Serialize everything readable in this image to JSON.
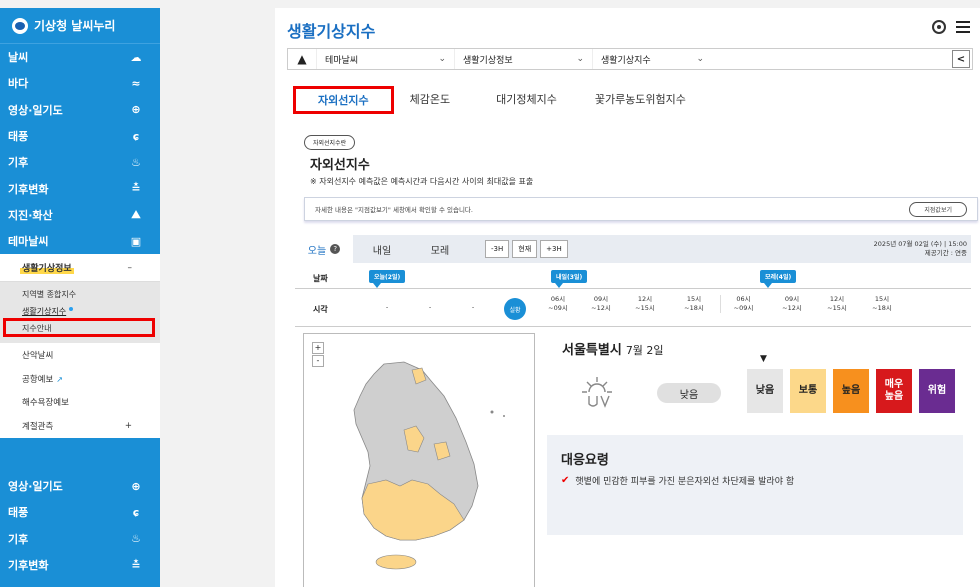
{
  "sidebar": {
    "logo": "기상청 날씨누리",
    "items": [
      {
        "label": "날씨",
        "icon": "cloud-sun-icon",
        "glyph": "☁"
      },
      {
        "label": "바다",
        "icon": "wave-icon",
        "glyph": "≈"
      },
      {
        "label": "영상·일기도",
        "icon": "satellite-icon",
        "glyph": "⊕"
      },
      {
        "label": "태풍",
        "icon": "typhoon-icon",
        "glyph": "ɕ"
      },
      {
        "label": "기후",
        "icon": "climate-icon",
        "glyph": "♨"
      },
      {
        "label": "기후변화",
        "icon": "thermometer-icon",
        "glyph": "≛"
      },
      {
        "label": "지진·화산",
        "icon": "volcano-icon",
        "glyph": "⛰"
      },
      {
        "label": "테마날씨",
        "icon": "theme-icon",
        "glyph": "▣"
      }
    ],
    "sub_head": "생활기상정보",
    "sub_head_toggle": "–",
    "sub_items": [
      "지역별 종합지수",
      "생활기상지수",
      "지수안내"
    ],
    "more_items": [
      {
        "label": "산악날씨",
        "trail": ""
      },
      {
        "label": "공항예보",
        "trail": "↗"
      },
      {
        "label": "해수욕장예보",
        "trail": ""
      },
      {
        "label": "계절관측",
        "trail": "+"
      }
    ],
    "bottom_items": [
      {
        "label": "영상·일기도",
        "glyph": "⊕"
      },
      {
        "label": "태풍",
        "glyph": "ɕ"
      },
      {
        "label": "기후",
        "glyph": "♨"
      },
      {
        "label": "기후변화",
        "glyph": "≛"
      }
    ]
  },
  "header": {
    "title": "생활기상지수"
  },
  "breadcrumb": {
    "items": [
      "테마날씨",
      "생활기상정보",
      "생활기상지수"
    ]
  },
  "tabs": [
    "자외선지수",
    "체감온도",
    "대기정체지수",
    "꽃가루농도위험지수"
  ],
  "section": {
    "chip": "자외선지수란",
    "title": "자외선지수",
    "note": "※ 자외선지수 예측값은 예측시간과 다음시간 사이의 최대값을 표출",
    "info": "자세한 내용은 \"지점값보기\" 세창에서 확인할 수 있습니다.",
    "info_button": "지점값보기"
  },
  "forecast": {
    "day_tabs": [
      "오늘",
      "내일",
      "모레"
    ],
    "time_buttons": [
      "-3H",
      "현재",
      "+3H"
    ],
    "issued": "2025년 07월 02일 (수) | 15:00",
    "provider": "제공기간 : 연중",
    "date_label": "날짜",
    "time_label": "시각",
    "badges": [
      "오늘(2일)",
      "내일(3일)",
      "모레(4일)"
    ],
    "now": "실황",
    "dashes": [
      "-",
      "-",
      "-"
    ],
    "times": [
      [
        "06시",
        "~09시"
      ],
      [
        "09시",
        "~12시"
      ],
      [
        "12시",
        "~15시"
      ],
      [
        "15시",
        "~18시"
      ],
      [
        "06시",
        "~09시"
      ],
      [
        "09시",
        "~12시"
      ],
      [
        "12시",
        "~15시"
      ],
      [
        "15시",
        "~18시"
      ]
    ]
  },
  "map": {
    "zoom_in": "+",
    "zoom_out": "-"
  },
  "detail": {
    "city": "서울특별시",
    "date": "7월 2일",
    "grade": "낮음",
    "scale": [
      {
        "label": "낮음",
        "color": "#e6e6e6",
        "text": "#222"
      },
      {
        "label": "보통",
        "color": "#fcd88a",
        "text": "#222"
      },
      {
        "label": "높음",
        "color": "#f7901e",
        "text": "#222"
      },
      {
        "label": "매우\n높음",
        "color": "#d7191c",
        "text": "#fff"
      },
      {
        "label": "위험",
        "color": "#6a2c91",
        "text": "#fff"
      }
    ],
    "marker": "▼"
  },
  "response": {
    "title": "대응요령",
    "items": [
      "햇볕에 민감한 피부를 가진 분은자외선 차단제를 발라야 함"
    ]
  },
  "colors": {
    "brand_blue": "#1a8fd6",
    "title_blue": "#1a6fc2",
    "highlight_red": "#e00000"
  }
}
